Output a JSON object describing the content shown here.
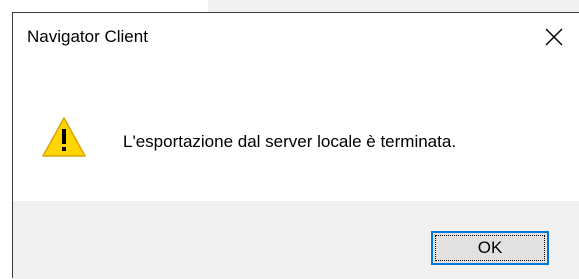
{
  "dialog": {
    "title": "Navigator Client",
    "close_icon": "close-icon",
    "warning_icon": "warning-icon",
    "message": "L'esportazione dal server locale è terminata.",
    "ok_label": "OK",
    "colors": {
      "content_bg": "#ffffff",
      "footer_bg": "#f0f0f0",
      "warning_fill": "#ffd500",
      "button_border": "#0078d7",
      "button_bg": "#e1e1e1"
    }
  }
}
